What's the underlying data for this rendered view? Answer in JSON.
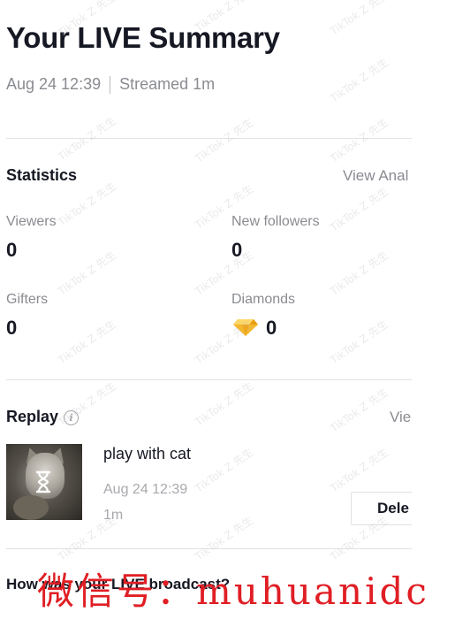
{
  "header": {
    "title": "Your LIVE Summary",
    "date": "Aug 24 12:39",
    "streamed": "Streamed 1m"
  },
  "statistics": {
    "title": "Statistics",
    "link": "View Anal",
    "items": [
      {
        "label": "Viewers",
        "value": "0"
      },
      {
        "label": "New followers",
        "value": "0"
      },
      {
        "label": "Gifters",
        "value": "0"
      },
      {
        "label": "Diamonds",
        "value": "0",
        "icon": "diamond-icon"
      }
    ]
  },
  "replay": {
    "title": "Replay",
    "info_icon": "i",
    "link": "Vie",
    "item": {
      "title": "play with cat",
      "date": "Aug 24 12:39",
      "duration": "1m",
      "delete_label": "Dele"
    }
  },
  "feedback": {
    "title": "How was your LIVE broadcast?"
  },
  "watermark": {
    "diagonal_text": "TikTok Z 先生",
    "bottom_text": "微信号：muhuanidc"
  },
  "colors": {
    "primary_text": "#161823",
    "secondary_text": "#8a8b91",
    "divider": "#e3e3e4",
    "diamond": "#f2b21b",
    "watermark_red": "#e01e24"
  }
}
